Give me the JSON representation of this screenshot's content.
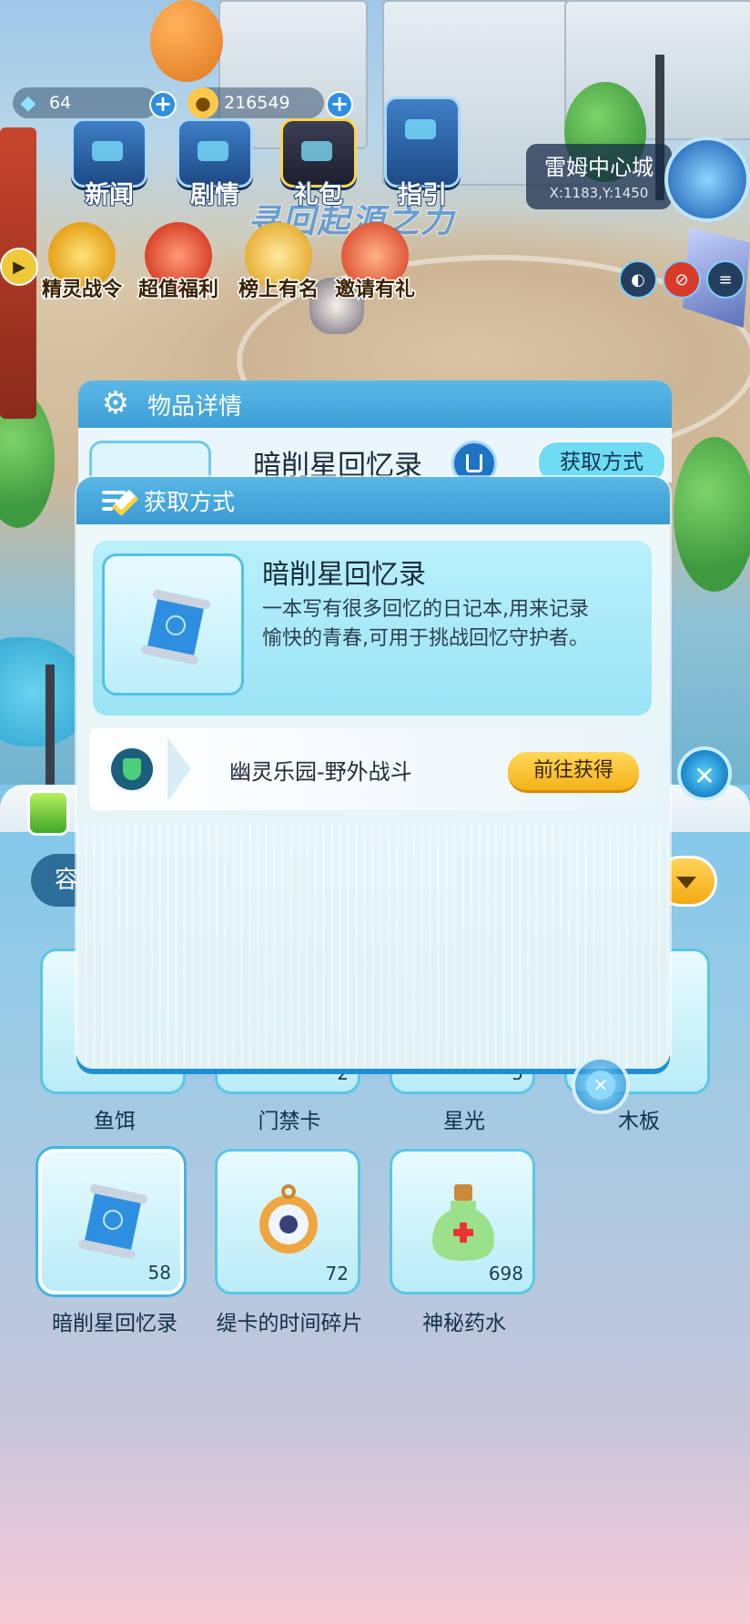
{
  "hud": {
    "gems": "64",
    "coins": "216549",
    "plus": "+",
    "top_buttons": [
      {
        "label": "新闻"
      },
      {
        "label": "剧情"
      },
      {
        "label": "礼包"
      },
      {
        "label": "指引"
      }
    ],
    "events": [
      {
        "label": "精灵战令"
      },
      {
        "label": "超值福利"
      },
      {
        "label": "榜上有名"
      },
      {
        "label": "邀请有礼"
      }
    ],
    "slogan": "寻回起源之力",
    "location": {
      "name": "雷姆中心城",
      "coords": "X:1183,Y:1450"
    }
  },
  "detail_modal": {
    "title": "物品详情",
    "item_name": "暗削星回忆录",
    "acquire_button": "获取方式"
  },
  "acquire_modal": {
    "title": "获取方式",
    "item_name": "暗削星回忆录",
    "description": "一本写有很多回忆的日记本,用来记录愉快的青春,可用于挑战回忆守护者。",
    "source": {
      "name": "幽灵乐园-野外战斗",
      "button": "前往获得"
    }
  },
  "bag": {
    "filter_label": "容",
    "items_row1": [
      {
        "name": "鱼饵",
        "count": ""
      },
      {
        "name": "门禁卡",
        "count": "2"
      },
      {
        "name": "星光",
        "count": "5"
      },
      {
        "name": "木板",
        "count": ""
      }
    ],
    "items_row2": [
      {
        "name": "暗削星回忆录",
        "count": "58",
        "icon": "scroll-icon"
      },
      {
        "name": "缇卡的时间碎片",
        "count": "72",
        "icon": "pocket-watch-icon"
      },
      {
        "name": "神秘药水",
        "count": "698",
        "icon": "potion-bottle-icon"
      }
    ]
  },
  "colors": {
    "accent": "#3d9ed6",
    "button_gold": "#f4b21a",
    "card_border": "#5bc6e6"
  }
}
